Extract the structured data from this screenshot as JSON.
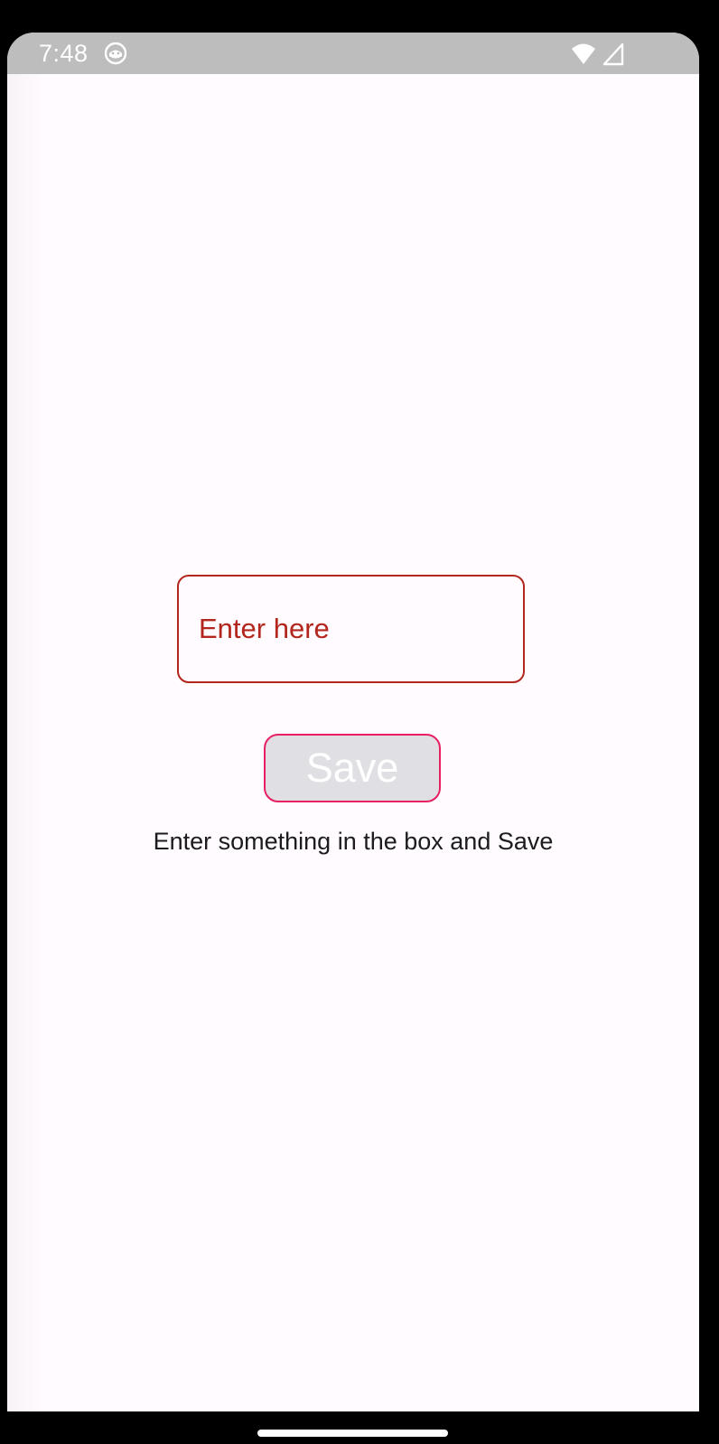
{
  "status_bar": {
    "time": "7:48",
    "icons": [
      "notification-app-icon",
      "wifi-icon",
      "cellular-signal-icon"
    ]
  },
  "form": {
    "input_placeholder": "Enter here",
    "input_value": "",
    "save_label": "Save",
    "hint": "Enter something in the box and Save"
  },
  "colors": {
    "status_bar_bg": "#bdbdbd",
    "page_bg": "#fffbfe",
    "error_red": "#b3261e",
    "button_border": "#e91e63",
    "button_bg": "#e0dfe3",
    "text": "#1c1b1f"
  }
}
